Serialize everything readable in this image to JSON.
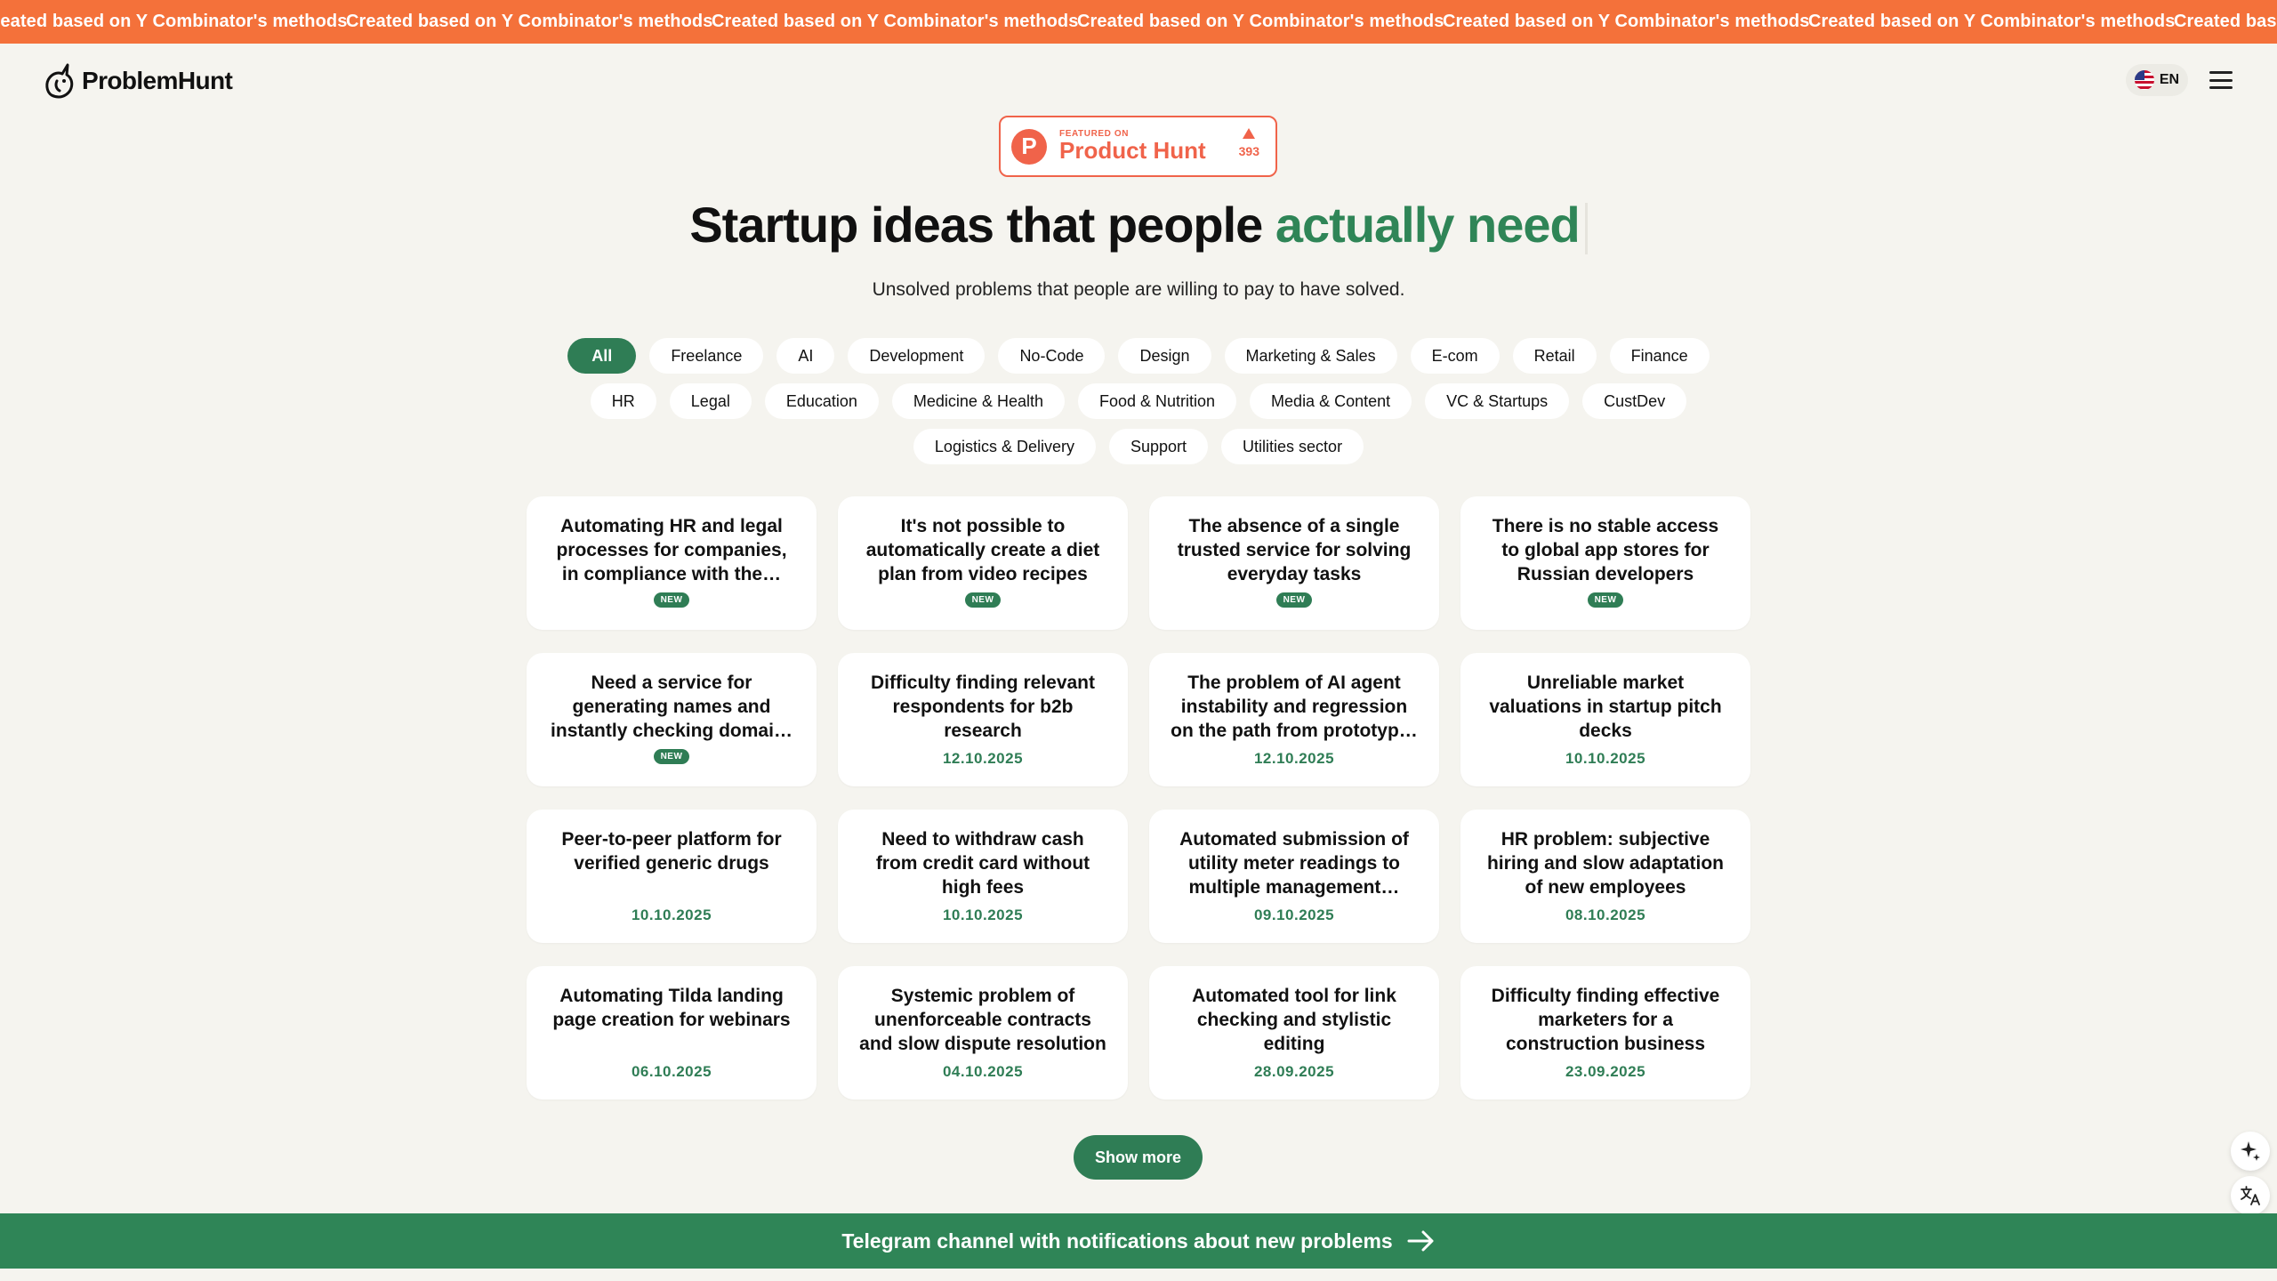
{
  "banner": {
    "items": [
      "Created based on Y Combinator's methods",
      "Created based on Y Combinator's methods",
      "Created based on Y Combinator's methods",
      "Created based on Y Combinator's methods",
      "Created based on Y Combinator's methods",
      "Created based on Y Combinator's methods",
      "Created based on Y Combinator's methods"
    ]
  },
  "header": {
    "logo_text": "ProblemHunt",
    "language": "EN"
  },
  "product_hunt": {
    "featured_label": "FEATURED ON",
    "name": "Product Hunt",
    "votes": "393",
    "logo_letter": "P"
  },
  "hero": {
    "title_main": "Startup ideas that people ",
    "title_accent": "actually need",
    "subtitle": "Unsolved problems that people are willing to pay to have solved."
  },
  "filters": {
    "rows": [
      [
        "All",
        "Freelance",
        "AI",
        "Development",
        "No-Code",
        "Design",
        "Marketing & Sales",
        "E-com",
        "Retail",
        "Finance"
      ],
      [
        "HR",
        "Legal",
        "Education",
        "Medicine & Health",
        "Food & Nutrition",
        "Media & Content",
        "VC & Startups",
        "CustDev"
      ],
      [
        "Logistics & Delivery",
        "Support",
        "Utilities sector"
      ]
    ],
    "active": "All"
  },
  "cards": [
    {
      "title": "Automating HR and legal processes for companies, in compliance with the…",
      "badge": "NEW",
      "date": ""
    },
    {
      "title": "It's not possible to automatically create a diet plan from video recipes",
      "badge": "NEW",
      "date": ""
    },
    {
      "title": "The absence of a single trusted service for solving everyday tasks",
      "badge": "NEW",
      "date": ""
    },
    {
      "title": "There is no stable access to global app stores for Russian developers",
      "badge": "NEW",
      "date": ""
    },
    {
      "title": "Need a service for generating names and instantly checking domai…",
      "badge": "NEW",
      "date": ""
    },
    {
      "title": "Difficulty finding relevant respondents for b2b research",
      "badge": "",
      "date": "12.10.2025"
    },
    {
      "title": "The problem of AI agent instability and regression on the path from prototyp…",
      "badge": "",
      "date": "12.10.2025"
    },
    {
      "title": "Unreliable market valuations in startup pitch decks",
      "badge": "",
      "date": "10.10.2025"
    },
    {
      "title": "Peer-to-peer platform for verified generic drugs",
      "badge": "",
      "date": "10.10.2025"
    },
    {
      "title": "Need to withdraw cash from credit card without high fees",
      "badge": "",
      "date": "10.10.2025"
    },
    {
      "title": "Automated submission of utility meter readings to multiple management…",
      "badge": "",
      "date": "09.10.2025"
    },
    {
      "title": "HR problem: subjective hiring and slow adaptation of new employees",
      "badge": "",
      "date": "08.10.2025"
    },
    {
      "title": "Automating Tilda landing page creation for webinars",
      "badge": "",
      "date": "06.10.2025"
    },
    {
      "title": "Systemic problem of unenforceable contracts and slow dispute resolution",
      "badge": "",
      "date": "04.10.2025"
    },
    {
      "title": "Automated tool for link checking and stylistic editing",
      "badge": "",
      "date": "28.09.2025"
    },
    {
      "title": "Difficulty finding effective marketers for a construction business",
      "badge": "",
      "date": "23.09.2025"
    }
  ],
  "show_more": "Show more",
  "telegram_bar": "Telegram channel with notifications about new problems",
  "colors": {
    "banner": "#f4713a",
    "accent_green": "#2f7d55",
    "product_hunt": "#f0634a",
    "background": "#f5f4ef"
  },
  "icons": {
    "logo": "unicorn-icon",
    "language": "us-flag-icon",
    "menu": "hamburger-menu-icon",
    "ai_assist": "sparkle-icon",
    "translate": "translate-icon",
    "telegram_arrow": "arrow-right-icon"
  }
}
